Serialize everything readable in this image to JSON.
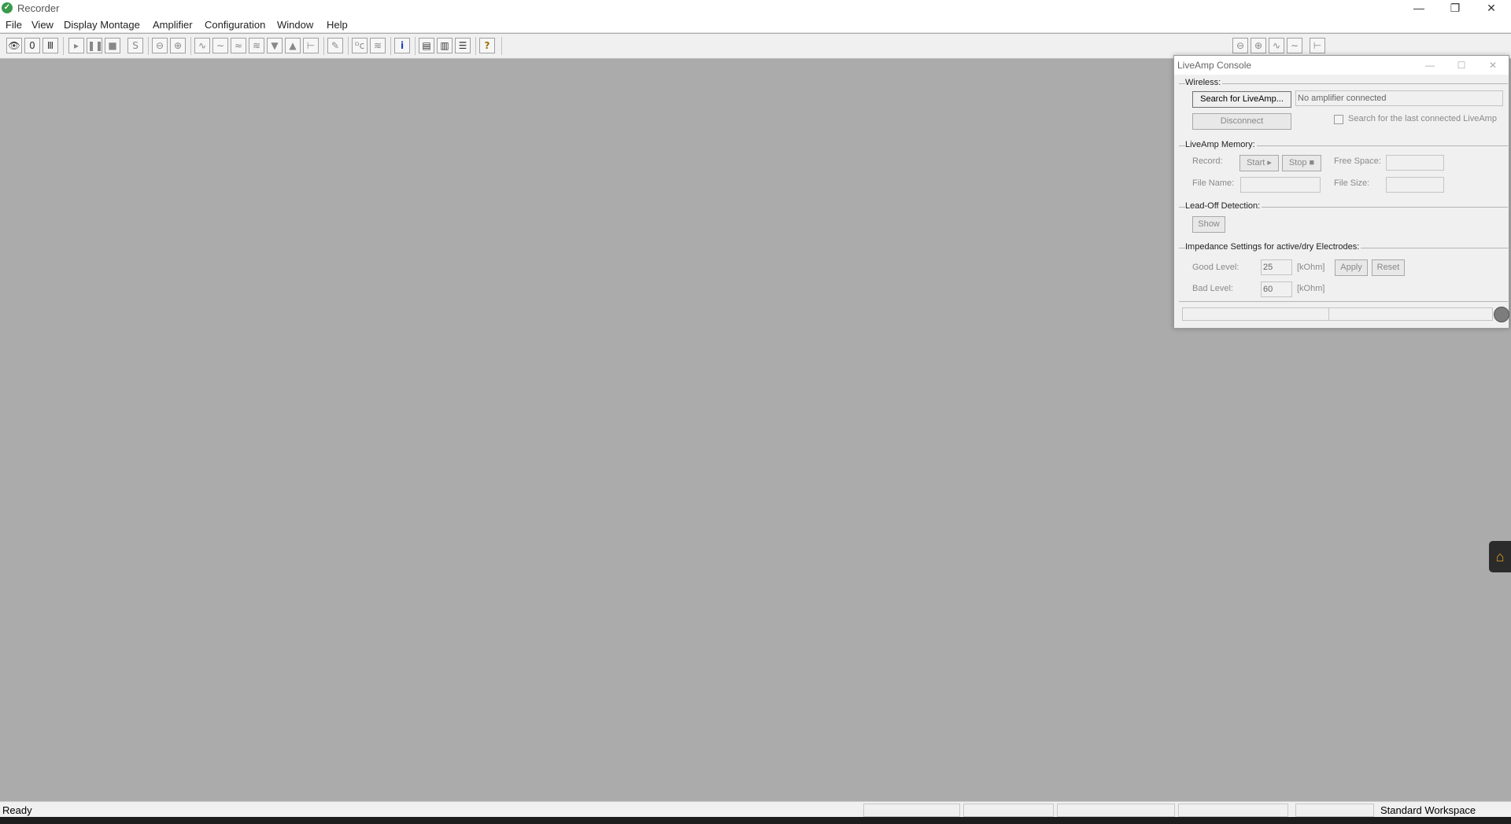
{
  "window": {
    "title": "Recorder",
    "app_icon": "recorder-logo-icon",
    "controls": {
      "minimize": "—",
      "maximize": "❐",
      "close": "✕"
    }
  },
  "menu": {
    "items": [
      "File",
      "View",
      "Display Montage",
      "Amplifier",
      "Configuration",
      "Window",
      "Help"
    ]
  },
  "toolbar": {
    "buttons": [
      {
        "icon": "monitor-eye-icon",
        "glyph": "👁"
      },
      {
        "icon": "test-signal-icon",
        "glyph": "0"
      },
      {
        "icon": "impedance-icon",
        "glyph": "Ⅲ"
      },
      {
        "icon": "record-start-icon",
        "glyph": "▸"
      },
      {
        "icon": "pause-icon",
        "glyph": "❚❚"
      },
      {
        "icon": "stop-icon",
        "glyph": "■"
      },
      {
        "icon": "save-icon",
        "glyph": "S"
      },
      {
        "icon": "zoom-out-icon",
        "glyph": "⊖"
      },
      {
        "icon": "zoom-in-icon",
        "glyph": "⊕"
      },
      {
        "icon": "wave-scale-up-icon",
        "glyph": "∿"
      },
      {
        "icon": "wave-scale-down-icon",
        "glyph": "∼"
      },
      {
        "icon": "wave-filter-icon",
        "glyph": "≈"
      },
      {
        "icon": "channels-icon",
        "glyph": "≋"
      },
      {
        "icon": "arrow-down-icon",
        "glyph": "▼"
      },
      {
        "icon": "arrow-up-icon",
        "glyph": "▲"
      },
      {
        "icon": "baseline-icon",
        "glyph": "⊢"
      },
      {
        "icon": "pencil-icon",
        "glyph": "✎"
      },
      {
        "icon": "dc-correction-icon",
        "glyph": "ᴰc"
      },
      {
        "icon": "filter-icon",
        "glyph": "≋"
      },
      {
        "icon": "info-icon",
        "glyph": "i"
      },
      {
        "icon": "layout-icon",
        "glyph": "▤"
      },
      {
        "icon": "split-view-icon",
        "glyph": "▥"
      },
      {
        "icon": "stack-view-icon",
        "glyph": "☰"
      },
      {
        "icon": "help-icon",
        "glyph": "?"
      }
    ],
    "right_buttons": [
      {
        "icon": "zoom-out-icon",
        "glyph": "⊖"
      },
      {
        "icon": "zoom-in-icon",
        "glyph": "⊕"
      },
      {
        "icon": "wave-scale-icon",
        "glyph": "∿"
      },
      {
        "icon": "wave-scale-down-icon",
        "glyph": "∼"
      },
      {
        "icon": "baseline-icon",
        "glyph": "⊢"
      }
    ]
  },
  "console": {
    "title": "LiveAmp Console",
    "controls": {
      "minimize": "—",
      "maximize": "☐",
      "close": "✕"
    },
    "wireless": {
      "label": "Wireless:",
      "search_button": "Search for LiveAmp...",
      "status_value": "No amplifier connected",
      "disconnect_button": "Disconnect",
      "last_connected_label": "Search for the last connected LiveAmp",
      "last_connected_checked": false
    },
    "memory": {
      "label": "LiveAmp Memory:",
      "record_label": "Record:",
      "start_button": "Start",
      "stop_button": "Stop",
      "free_space_label": "Free Space:",
      "free_space_value": "",
      "file_name_label": "File Name:",
      "file_name_value": "",
      "file_size_label": "File Size:",
      "file_size_value": ""
    },
    "lead_off": {
      "label": "Lead-Off Detection:",
      "show_button": "Show"
    },
    "impedance": {
      "label": "Impedance Settings for active/dry Electrodes:",
      "good_label": "Good Level:",
      "good_value": "25",
      "bad_label": "Bad Level:",
      "bad_value": "60",
      "unit": "[kOhm]",
      "apply_button": "Apply",
      "reset_button": "Reset"
    }
  },
  "statusbar": {
    "text": "Ready",
    "workspace": "Standard Workspace"
  },
  "colors": {
    "workspace_bg": "#ababab",
    "chrome_bg": "#f0f0f0",
    "app_icon": "#3a9a4a",
    "side_handle_icon": "#e0a020"
  },
  "side_handle": {
    "icon": "plugin-handle-icon"
  }
}
